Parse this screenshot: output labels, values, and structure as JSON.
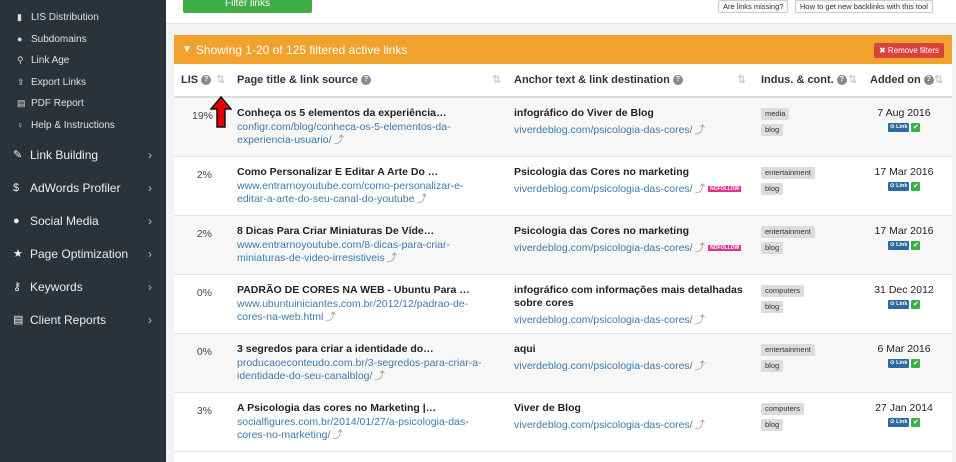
{
  "sidebar": {
    "sub_items": [
      {
        "icon": "bar-chart-icon",
        "glyph": "▮",
        "label": "LIS Distribution"
      },
      {
        "icon": "globe-icon",
        "glyph": "●",
        "label": "Subdomains"
      },
      {
        "icon": "link-icon",
        "glyph": "⚲",
        "label": "Link Age"
      },
      {
        "icon": "export-icon",
        "glyph": "⇪",
        "label": "Export Links"
      },
      {
        "icon": "pdf-icon",
        "glyph": "▤",
        "label": "PDF Report"
      },
      {
        "icon": "lightbulb-icon",
        "glyph": "♀",
        "label": "Help & Instructions"
      }
    ],
    "main_items": [
      {
        "icon": "wrench-icon",
        "glyph": "✎",
        "label": "Link Building"
      },
      {
        "icon": "dollar-icon",
        "glyph": "$",
        "label": "AdWords Profiler"
      },
      {
        "icon": "comments-icon",
        "glyph": "●",
        "label": "Social Media"
      },
      {
        "icon": "star-icon",
        "glyph": "★",
        "label": "Page Optimization"
      },
      {
        "icon": "key-icon",
        "glyph": "⚷",
        "label": "Keywords"
      },
      {
        "icon": "file-icon",
        "glyph": "▤",
        "label": "Client Reports"
      }
    ]
  },
  "top": {
    "filter_button": "Filter links",
    "missing_button": "Are links missing?",
    "howto_button": "How to get new backlinks with this tool"
  },
  "banner": {
    "text": "Showing 1-20 of 125 filtered active links",
    "remove_button": "Remove filters"
  },
  "columns": {
    "lis": "LIS",
    "title": "Page title & link source",
    "anchor": "Anchor text & link destination",
    "industry": "Indus. & cont.",
    "added": "Added on"
  },
  "badges": {
    "link": "Link",
    "check": "✔",
    "nofollow": "NOFOLLOW"
  },
  "rows": [
    {
      "lis": "19%",
      "title": "Conheça os 5 elementos da experiência…",
      "source": "configr.com/blog/conheca-os-5-elementos-da-experiencia-usuario/",
      "anchor": "infográfico do Viver de Blog",
      "dest": "viverdeblog.com/psicologia-das-cores/",
      "nofollow": false,
      "tags": [
        "media",
        "blog"
      ],
      "added": "7 Aug 2016"
    },
    {
      "lis": "2%",
      "title": "Como Personalizar E Editar A Arte Do …",
      "source": "www.entrarnoyoutube.com/como-personalizar-e-editar-a-arte-do-seu-canal-do-youtube",
      "anchor": "Psicologia das Cores no marketing",
      "dest": "viverdeblog.com/psicologia-das-cores/",
      "nofollow": true,
      "tags": [
        "entertainment",
        "blog"
      ],
      "added": "17 Mar 2016"
    },
    {
      "lis": "2%",
      "title": "8 Dicas Para Criar Miniaturas De Víde…",
      "source": "www.entrarnoyoutube.com/8-dicas-para-criar-miniaturas-de-video-irresistiveis",
      "anchor": "Psicologia das Cores no marketing",
      "dest": "viverdeblog.com/psicologia-das-cores/",
      "nofollow": true,
      "tags": [
        "entertainment",
        "blog"
      ],
      "added": "17 Mar 2016"
    },
    {
      "lis": "0%",
      "title": "PADRÃO DE CORES NA WEB - Ubuntu Para …",
      "source": "www.ubuntuiniciantes.com.br/2012/12/padrao-de-cores-na-web.html",
      "anchor": "infográfico com informações mais detalhadas sobre cores",
      "dest": "viverdeblog.com/psicologia-das-cores/",
      "nofollow": false,
      "tags": [
        "computers",
        "blog"
      ],
      "added": "31 Dec 2012"
    },
    {
      "lis": "0%",
      "title": "3 segredos para criar a identidade do…",
      "source": "producaoeconteudo.com.br/3-segredos-para-criar-a-identidade-do-seu-canalblog/",
      "anchor": "aqui",
      "dest": "viverdeblog.com/psicologia-das-cores/",
      "nofollow": false,
      "tags": [
        "entertainment",
        "blog"
      ],
      "added": "6 Mar 2016"
    },
    {
      "lis": "3%",
      "title": "A Psicologia das cores no Marketing |…",
      "source": "socialfigures.com.br/2014/01/27/a-psicologia-das-cores-no-marketing/",
      "anchor": "Viver de Blog",
      "dest": "viverdeblog.com/psicologia-das-cores/",
      "nofollow": false,
      "tags": [
        "computers",
        "blog"
      ],
      "added": "27 Jan 2014"
    }
  ],
  "colors": {
    "banner": "#f0a22c",
    "sidebar": "#2c3338",
    "link": "#3d7ab0",
    "green": "#3fae49",
    "remove": "#d9433a",
    "annotation_arrow": "#e00000"
  }
}
